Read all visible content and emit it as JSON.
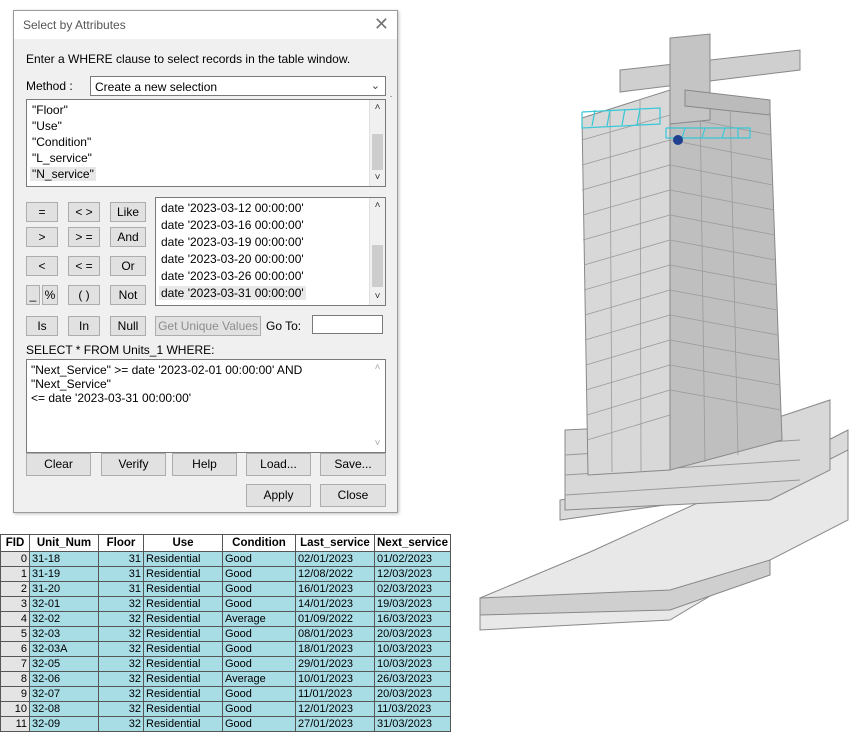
{
  "dialog": {
    "title": "Select by Attributes",
    "close_glyph": "✕",
    "instruction": "Enter a WHERE clause to select records in the table window.",
    "method_label": "Method :",
    "method_value": "Create a new selection",
    "fields": [
      "\"Floor\"",
      "\"Use\"",
      "\"Condition\"",
      "\"L_service\"",
      "\"N_service\""
    ],
    "operators": {
      "eq": "=",
      "ne": "< >",
      "like": "Like",
      "gt": ">",
      "ge": "> =",
      "and": "And",
      "lt": "<",
      "le": "< =",
      "or": "Or",
      "underscore": "_",
      "percent": "%",
      "parens": "( )",
      "not": "Not",
      "is": "Is",
      "in": "In",
      "null": "Null"
    },
    "values": [
      "date '2023-03-12 00:00:00'",
      "date '2023-03-16 00:00:00'",
      "date '2023-03-19 00:00:00'",
      "date '2023-03-20 00:00:00'",
      "date '2023-03-26 00:00:00'",
      "date '2023-03-31 00:00:00'"
    ],
    "get_unique_values": "Get Unique Values",
    "goto_label": "Go To:",
    "goto_value": "",
    "select_statement": "SELECT * FROM Units_1 WHERE:",
    "where_clause": "\"Next_Service\" >= date '2023-02-01 00:00:00' AND \"Next_Service\"\n<= date '2023-03-31 00:00:00'",
    "buttons": {
      "clear": "Clear",
      "verify": "Verify",
      "help": "Help",
      "load": "Load...",
      "save": "Save...",
      "apply": "Apply",
      "close": "Close"
    }
  },
  "table": {
    "columns": [
      "FID",
      "Unit_Num",
      "Floor",
      "Use",
      "Condition",
      "Last_service",
      "Next_service"
    ],
    "rows": [
      [
        "0",
        "31-18",
        "31",
        "Residential",
        "Good",
        "02/01/2023",
        "01/02/2023"
      ],
      [
        "1",
        "31-19",
        "31",
        "Residential",
        "Good",
        "12/08/2022",
        "12/03/2023"
      ],
      [
        "2",
        "31-20",
        "31",
        "Residential",
        "Good",
        "16/01/2023",
        "02/03/2023"
      ],
      [
        "3",
        "32-01",
        "32",
        "Residential",
        "Good",
        "14/01/2023",
        "19/03/2023"
      ],
      [
        "4",
        "32-02",
        "32",
        "Residential",
        "Average",
        "01/09/2022",
        "16/03/2023"
      ],
      [
        "5",
        "32-03",
        "32",
        "Residential",
        "Good",
        "08/01/2023",
        "20/03/2023"
      ],
      [
        "6",
        "32-03A",
        "32",
        "Residential",
        "Good",
        "18/01/2023",
        "10/03/2023"
      ],
      [
        "7",
        "32-05",
        "32",
        "Residential",
        "Good",
        "29/01/2023",
        "10/03/2023"
      ],
      [
        "8",
        "32-06",
        "32",
        "Residential",
        "Average",
        "10/01/2023",
        "26/03/2023"
      ],
      [
        "9",
        "32-07",
        "32",
        "Residential",
        "Good",
        "11/01/2023",
        "20/03/2023"
      ],
      [
        "10",
        "32-08",
        "32",
        "Residential",
        "Good",
        "12/01/2023",
        "11/03/2023"
      ],
      [
        "11",
        "32-09",
        "32",
        "Residential",
        "Good",
        "27/01/2023",
        "31/03/2023"
      ]
    ]
  },
  "colors": {
    "selected_row": "#a9dde6",
    "highlight_units": "#38c8d8",
    "marker": "#1f3f8f",
    "building": "#d4d4d4"
  }
}
